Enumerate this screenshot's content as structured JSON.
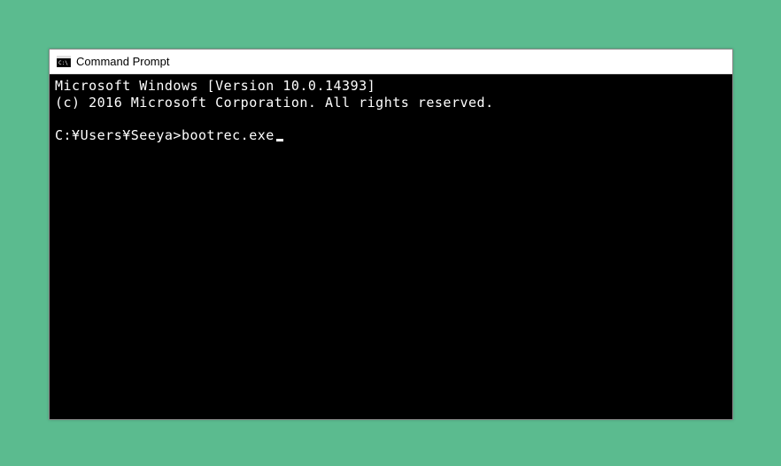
{
  "window": {
    "title": "Command Prompt"
  },
  "terminal": {
    "line1": "Microsoft Windows [Version 10.0.14393]",
    "line2": "(c) 2016 Microsoft Corporation. All rights reserved.",
    "prompt": "C:¥Users¥Seeya>",
    "command": "bootrec.exe"
  }
}
